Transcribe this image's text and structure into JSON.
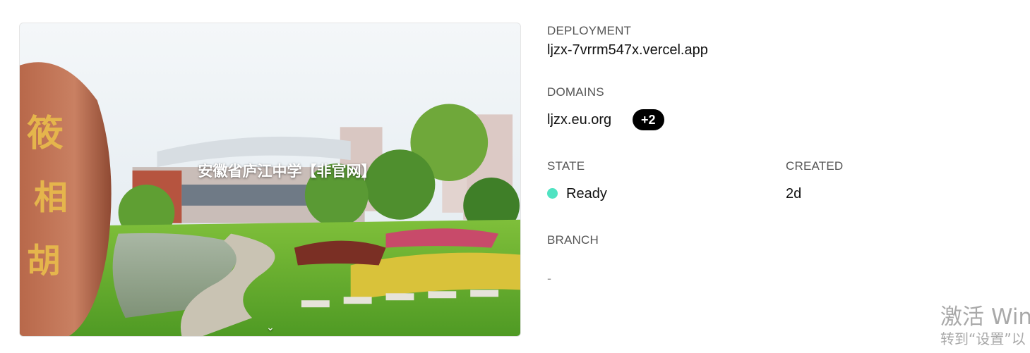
{
  "preview": {
    "caption": "安徽省庐江中学【非官网】",
    "expand_icon": "chevron-down-icon"
  },
  "deployment": {
    "label": "DEPLOYMENT",
    "url": "ljzx-7vrrm547x.vercel.app"
  },
  "domains": {
    "label": "DOMAINS",
    "primary": "ljzx.eu.org",
    "extra_count": "+2"
  },
  "state": {
    "label": "STATE",
    "value": "Ready",
    "color": "#50e3c2"
  },
  "created": {
    "label": "CREATED",
    "value": "2d"
  },
  "branch": {
    "label": "BRANCH",
    "value": "-"
  },
  "watermark": {
    "line1": "激活 Win",
    "line2": "转到“设置”以"
  }
}
